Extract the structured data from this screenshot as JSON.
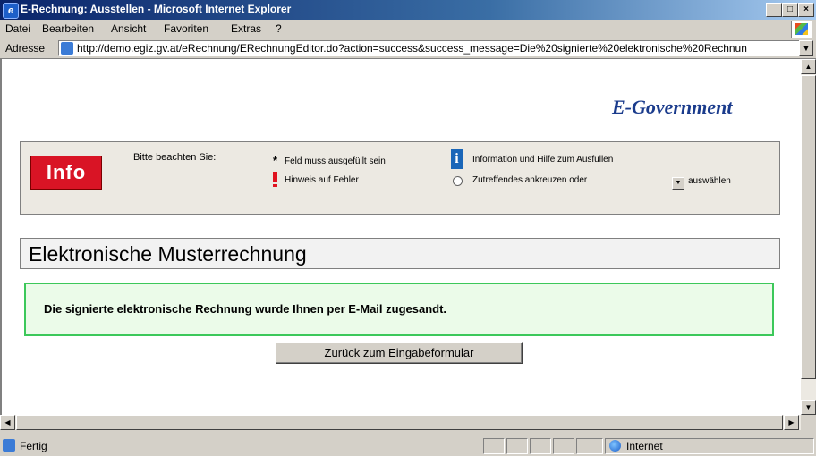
{
  "window": {
    "title": "E-Rechnung: Ausstellen - Microsoft Internet Explorer",
    "minimize_label": "_",
    "maximize_label": "□",
    "close_label": "×"
  },
  "menu": {
    "items": [
      "Datei",
      "Bearbeiten",
      "Ansicht",
      "Favoriten",
      "Extras",
      "?"
    ]
  },
  "address": {
    "label": "Adresse",
    "url": "http://demo.egiz.gv.at/eRechnung/ERechnungEditor.do?action=success&success_message=Die%20signierte%20elektronische%20Rechnun"
  },
  "page": {
    "brand": "E-Government",
    "info_badge": "Info",
    "info_title": "Bitte beachten Sie:",
    "legend": {
      "required": "Feld muss ausgefüllt sein",
      "error": "Hinweis auf Fehler",
      "help": "Information und Hilfe zum Ausfüllen",
      "radio": "Zutreffendes ankreuzen oder",
      "select": "auswählen"
    },
    "heading": "Elektronische Musterrechnung",
    "success_message": "Die signierte elektronische Rechnung wurde Ihnen per E-Mail zugesandt.",
    "back_button": "Zurück zum Eingabeformular"
  },
  "status": {
    "text": "Fertig",
    "zone": "Internet"
  },
  "colors": {
    "info_badge": "#d91425",
    "success_border": "#3cc85a",
    "brand": "#1a3b8c",
    "titlebar": "#0a246a"
  }
}
